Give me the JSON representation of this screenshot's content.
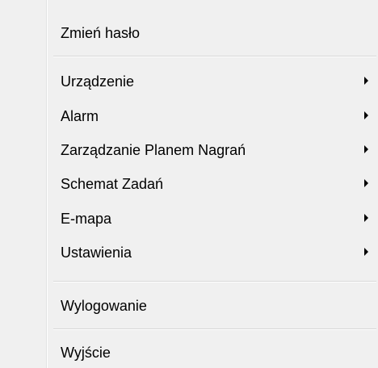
{
  "menu": {
    "items": [
      {
        "label": "Zmień hasło",
        "submenu": false
      },
      {
        "label": "Urządzenie",
        "submenu": true
      },
      {
        "label": "Alarm",
        "submenu": true
      },
      {
        "label": "Zarządzanie Planem Nagrań",
        "submenu": true
      },
      {
        "label": "Schemat Zadań",
        "submenu": true
      },
      {
        "label": "E-mapa",
        "submenu": true
      },
      {
        "label": "Ustawienia",
        "submenu": true
      },
      {
        "label": "Wylogowanie",
        "submenu": false
      },
      {
        "label": "Wyjście",
        "submenu": false
      }
    ]
  }
}
